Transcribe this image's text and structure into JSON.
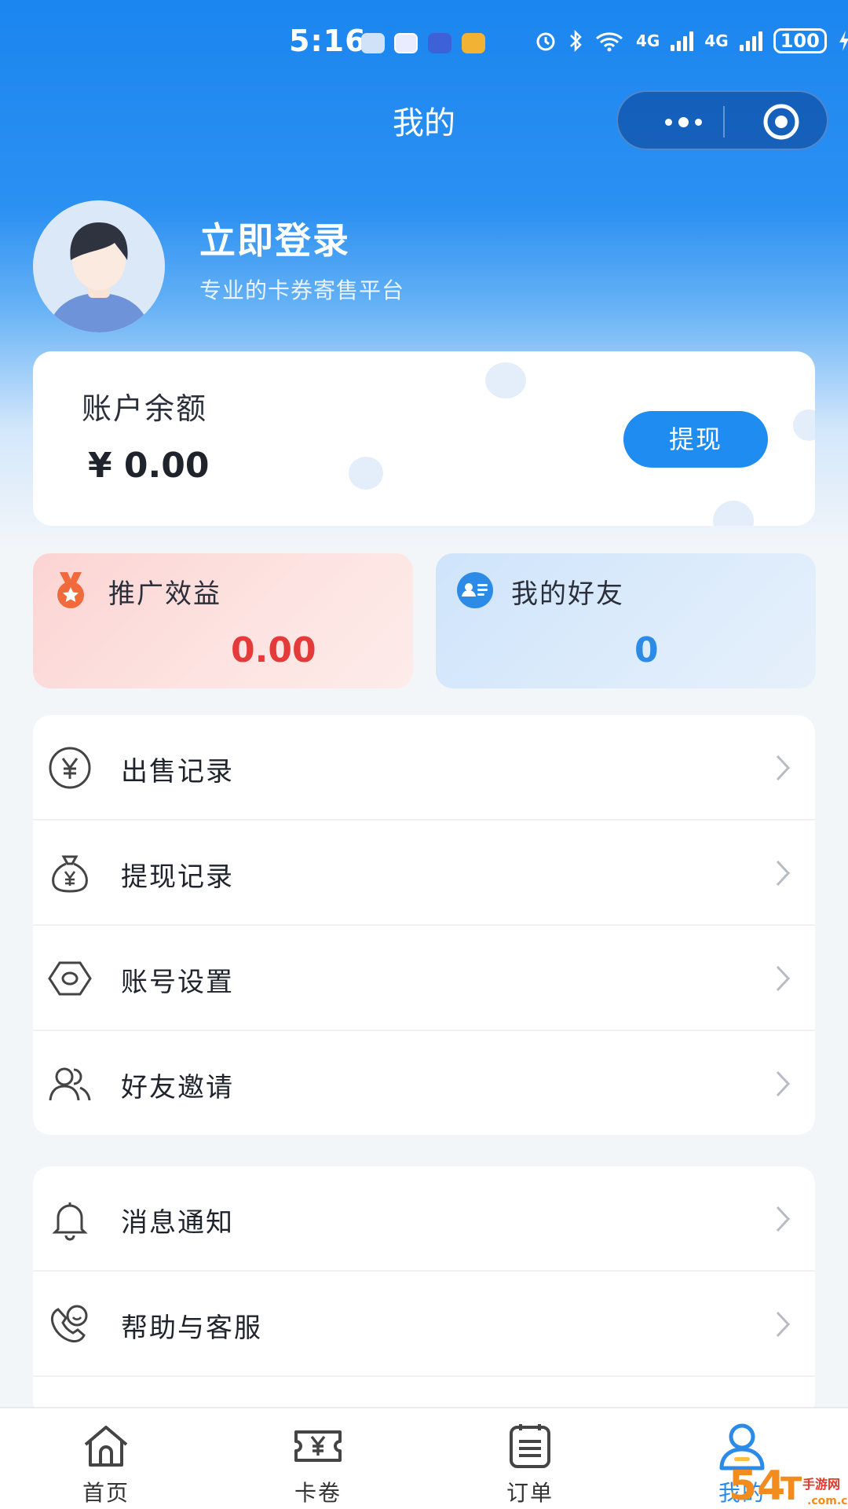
{
  "status_bar": {
    "time": "5:16",
    "network_label": "4G",
    "battery": "100"
  },
  "nav": {
    "title": "我的"
  },
  "profile": {
    "title": "立即登录",
    "subtitle": "专业的卡券寄售平台"
  },
  "balance": {
    "label": "账户余额",
    "value": "¥ 0.00",
    "button_label": "提现"
  },
  "stats": {
    "promo": {
      "label": "推广效益",
      "value": "0.00"
    },
    "friends": {
      "label": "我的好友",
      "value": "0"
    }
  },
  "menu_group_1": [
    {
      "label": "出售记录",
      "icon": "yen-circle-icon"
    },
    {
      "label": "提现记录",
      "icon": "money-bag-icon"
    },
    {
      "label": "账号设置",
      "icon": "hexagon-settings-icon"
    },
    {
      "label": "好友邀请",
      "icon": "users-icon"
    }
  ],
  "menu_group_2": [
    {
      "label": "消息通知",
      "icon": "bell-icon"
    },
    {
      "label": "帮助与客服",
      "icon": "customer-service-icon"
    }
  ],
  "tabbar": [
    {
      "label": "首页",
      "icon": "home-icon"
    },
    {
      "label": "卡卷",
      "icon": "ticket-icon"
    },
    {
      "label": "订单",
      "icon": "order-list-icon"
    },
    {
      "label": "我的",
      "icon": "user-icon",
      "active": true
    }
  ],
  "colors": {
    "primary": "#1e8cf0",
    "promo_value": "#e43a3a",
    "friends_value": "#2b8be6"
  }
}
